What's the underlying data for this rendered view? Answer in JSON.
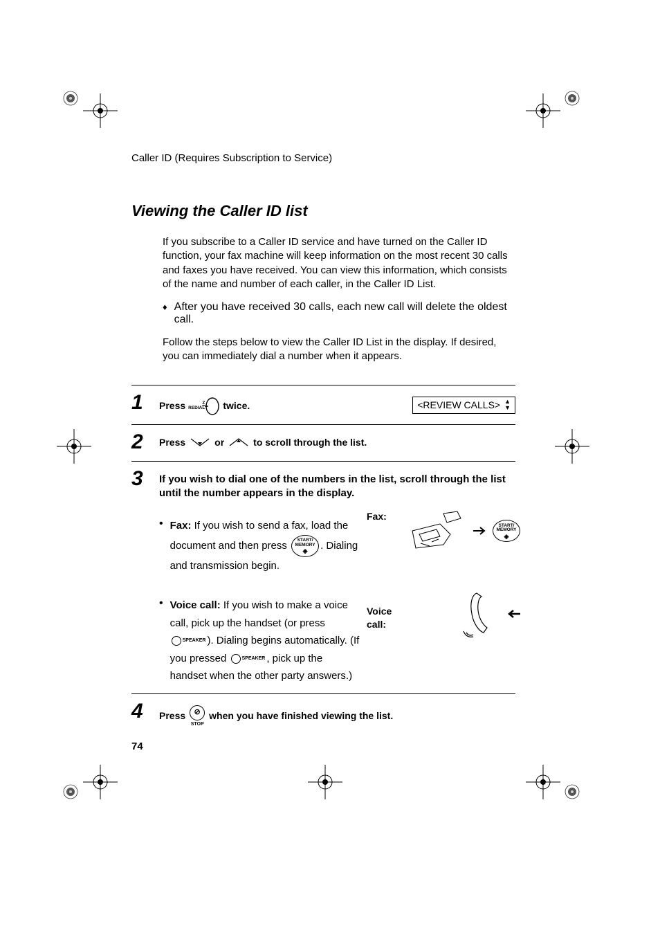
{
  "header": "Caller ID (Requires Subscription to Service)",
  "title": "Viewing the Caller ID list",
  "intro": {
    "p1": "If you subscribe to a Caller ID service and have turned on the Caller ID function, your fax machine will keep information on the most recent 30 calls and faxes you have received. You can view this information, which consists of the name and number of each caller, in the Caller ID List.",
    "bullet": "After you have received 30 calls, each new call will delete the oldest call.",
    "p2": "Follow the steps below to view the Caller ID List in the display. If desired, you can immediately dial a number when it appears."
  },
  "lcd": "<REVIEW CALLS>",
  "steps": {
    "n1": "1",
    "s1_press": "Press",
    "s1_twice": "twice.",
    "n2": "2",
    "s2_press": "Press",
    "s2_or": "or",
    "s2_rest": "to  scroll through the list.",
    "n3": "3",
    "s3_lead": "If you wish to dial one of the numbers in the list, scroll through the list until the number appears in the display.",
    "s3_fax_label": "Fax:",
    "s3_fax_a": "If you wish to send a fax, load the",
    "s3_fax_b": "document and then press",
    "s3_fax_c": ".",
    "s3_fax_d": "Dialing and transmission begin.",
    "s3_fax_side": "Fax:",
    "s3_voice_label": "Voice call:",
    "s3_voice_a": "If you wish to make a voice call, pick up the handset (or press",
    "s3_voice_b": "). Dialing begins automatically.",
    "s3_voice_c": "(If you pressed",
    "s3_voice_d": ", pick up the handset when the other party answers.)",
    "s3_voice_side1": "Voice",
    "s3_voice_side2": "call:",
    "n4": "4",
    "s4_press": "Press",
    "s4_rest": "when you have finished viewing the list."
  },
  "buttons": {
    "redial": "REDIAL",
    "redial_z": "Z",
    "start1": "START/",
    "start2": "MEMORY",
    "speaker": "SPEAKER",
    "stop": "STOP"
  },
  "page_number": "74"
}
